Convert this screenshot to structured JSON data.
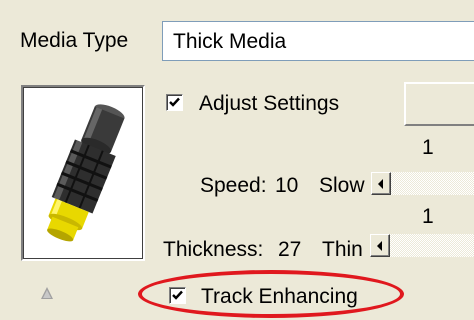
{
  "media_type": {
    "label": "Media Type",
    "value": "Thick Media"
  },
  "cartridge_image": {
    "icon": "print-cartridge-icon",
    "accent_color": "#E8D800"
  },
  "adjust_settings": {
    "label": "Adjust Settings",
    "checked": true
  },
  "speed": {
    "label": "Speed:",
    "value": "10",
    "range_label": "Slow",
    "tick_label": "1"
  },
  "thickness": {
    "label": "Thickness:",
    "value": "27",
    "range_label": "Thin",
    "tick_label": "1"
  },
  "track_enhancing": {
    "label": "Track Enhancing",
    "checked": true
  },
  "annotation": {
    "highlight_color": "#E0181E"
  }
}
